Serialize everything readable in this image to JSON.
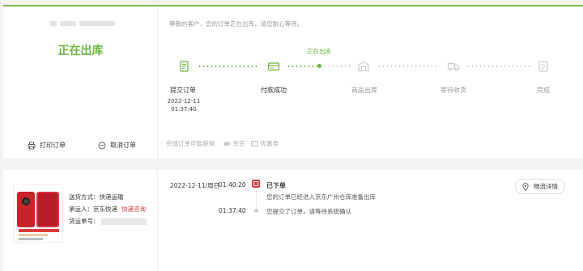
{
  "order": {
    "status": "正在出库",
    "notice": "尊敬的客户，您的订单正在出库，请您耐心等待。",
    "actions": {
      "print": "打印订单",
      "cancel": "取消订单"
    }
  },
  "progress": {
    "current_label": "正在出库",
    "steps": [
      {
        "label": "提交订单",
        "state": "done",
        "date": "2022-12-11",
        "time": "01:37:40",
        "icon": "submit-order-icon"
      },
      {
        "label": "付款成功",
        "state": "done",
        "icon": "payment-icon"
      },
      {
        "label": "商品出库",
        "state": "todo",
        "icon": "warehouse-icon"
      },
      {
        "label": "等待收货",
        "state": "todo",
        "icon": "truck-icon"
      },
      {
        "label": "完成",
        "state": "todo",
        "icon": "complete-icon"
      }
    ]
  },
  "rewards": {
    "prefix": "完成订单可能获得：",
    "items": [
      "京豆",
      "优惠券"
    ]
  },
  "shipping": {
    "method_label": "送货方式：快递运输",
    "carrier_label": "承运人：京东快递",
    "carrier_link": "快递咨询",
    "tracking_label": "货运单号："
  },
  "tracking": {
    "date": "2022-12-11/周日",
    "entries": [
      {
        "time": "01:40:20",
        "title": "已下单",
        "desc": "您的订单已经进入京东广州仓库准备出库"
      },
      {
        "time": "01:37:40",
        "desc": "您提交了订单，请等待系统确认"
      }
    ],
    "detail_button": "物流详情"
  },
  "colors": {
    "accent": "#6cb43f",
    "red": "#e4393c"
  }
}
